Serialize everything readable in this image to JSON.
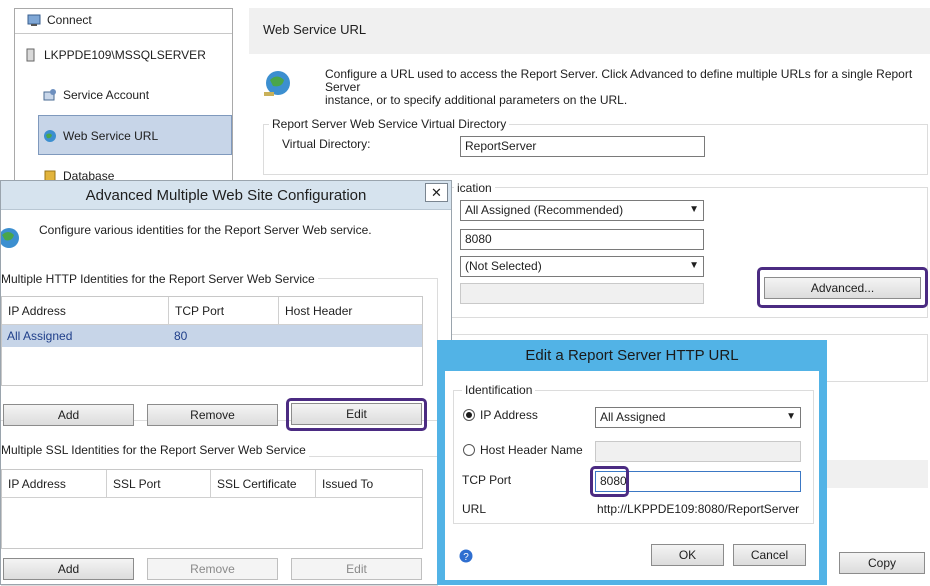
{
  "nav": {
    "connect": "Connect",
    "server": "LKPPDE109\\MSSQLSERVER",
    "service_account": "Service Account",
    "web_service_url": "Web Service URL",
    "database": "Database"
  },
  "main": {
    "title": "Web Service URL",
    "description_line1": "Configure a URL used to access the Report Server.  Click Advanced to define multiple URLs for a single Report Server",
    "description_line2": "instance, or to specify additional parameters on the URL.",
    "vdir_group": "Report Server Web Service Virtual Directory",
    "vdir_label": "Virtual Directory:",
    "vdir_value": "ReportServer",
    "identification_partial": "ication",
    "ip_value": "All Assigned (Recommended)",
    "port_value": "8080",
    "ssl_cert_value": "(Not Selected)",
    "advanced_label": "Advanced...",
    "copy_label": "Copy"
  },
  "dlg1": {
    "title": "Advanced Multiple Web Site Configuration",
    "close": "✕",
    "description": "Configure various identities for the Report Server Web service.",
    "http_group": "Multiple HTTP Identities for the Report Server Web Service",
    "http_headers": [
      "IP Address",
      "TCP Port",
      "Host Header"
    ],
    "http_row": [
      "All Assigned",
      "80",
      ""
    ],
    "add": "Add",
    "remove": "Remove",
    "edit": "Edit",
    "ssl_group": "Multiple SSL Identities for the Report Server Web Service",
    "ssl_headers": [
      "IP Address",
      "SSL Port",
      "SSL Certificate",
      "Issued To"
    ]
  },
  "dlg2": {
    "title": "Edit a Report Server HTTP URL",
    "identification": "Identification",
    "ip_label": "IP Address",
    "ip_value": "All Assigned",
    "host_label": "Host Header Name",
    "host_value": "",
    "port_label": "TCP Port",
    "port_value": "8080",
    "url_label": "URL",
    "url_value": "http://LKPPDE109:8080/ReportServer",
    "ok": "OK",
    "cancel": "Cancel"
  },
  "colors": {
    "highlight": "#4b2b82",
    "dialog_border": "#52b3e6",
    "selection": "#c7d5e8"
  }
}
